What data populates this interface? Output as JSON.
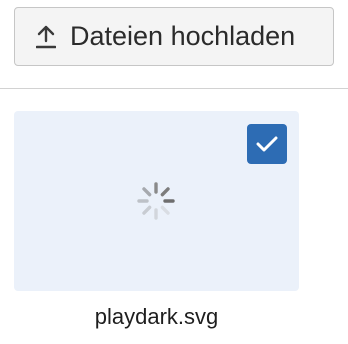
{
  "upload": {
    "label": "Dateien hochladen",
    "icon": "upload-icon"
  },
  "file": {
    "name": "playdark.svg",
    "selected": true,
    "status_icon": "loading-spinner-icon",
    "check_icon": "checkmark-icon"
  },
  "colors": {
    "accent": "#2d6cb4",
    "card_background": "#ebf1fa"
  }
}
